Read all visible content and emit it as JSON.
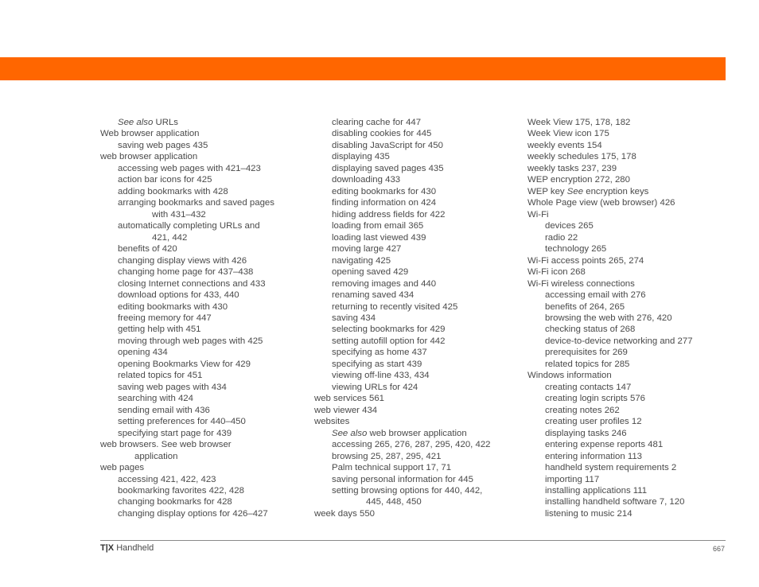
{
  "header": {
    "accent_color": "#ff6600"
  },
  "columns": [
    [
      {
        "level": 1,
        "italic": "See also",
        "text": " URLs"
      },
      {
        "level": 0,
        "text": "Web browser application"
      },
      {
        "level": 1,
        "text": "saving web pages 435"
      },
      {
        "level": 0,
        "text": "web browser application"
      },
      {
        "level": 1,
        "text": "accessing web pages with 421–423"
      },
      {
        "level": 1,
        "text": "action bar icons for 425"
      },
      {
        "level": 1,
        "text": "adding bookmarks with 428"
      },
      {
        "level": 1,
        "text": "arranging bookmarks and saved pages"
      },
      {
        "level": 2,
        "text": "with 431–432"
      },
      {
        "level": 1,
        "text": "automatically completing URLs and"
      },
      {
        "level": 2,
        "text": "421, 442"
      },
      {
        "level": 1,
        "text": "benefits of 420"
      },
      {
        "level": 1,
        "text": "changing display views with 426"
      },
      {
        "level": 1,
        "text": "changing home page for 437–438"
      },
      {
        "level": 1,
        "text": "closing Internet connections and 433"
      },
      {
        "level": 1,
        "text": "download options for 433, 440"
      },
      {
        "level": 1,
        "text": "editing bookmarks with 430"
      },
      {
        "level": 1,
        "text": "freeing memory for 447"
      },
      {
        "level": 1,
        "text": "getting help with 451"
      },
      {
        "level": 1,
        "text": "moving through web pages with 425"
      },
      {
        "level": 1,
        "text": "opening 434"
      },
      {
        "level": 1,
        "text": "opening Bookmarks View for 429"
      },
      {
        "level": 1,
        "text": "related topics for 451"
      },
      {
        "level": 1,
        "text": "saving web pages with 434"
      },
      {
        "level": 1,
        "text": "searching with 424"
      },
      {
        "level": 1,
        "text": "sending email with 436"
      },
      {
        "level": 1,
        "text": "setting preferences for 440–450"
      },
      {
        "level": 1,
        "text": "specifying start page for 439"
      },
      {
        "level": 0,
        "text": "web browsers. See web browser"
      },
      {
        "level": 2,
        "text": "application",
        "indent_small": true
      },
      {
        "level": 0,
        "text": "web pages"
      },
      {
        "level": 1,
        "text": "accessing 421, 422, 423"
      },
      {
        "level": 1,
        "text": "bookmarking favorites 422, 428"
      },
      {
        "level": 1,
        "text": "changing bookmarks for 428"
      },
      {
        "level": 1,
        "text": "changing display options for 426–427"
      }
    ],
    [
      {
        "level": 1,
        "text": "clearing cache for 447"
      },
      {
        "level": 1,
        "text": "disabling cookies for 445"
      },
      {
        "level": 1,
        "text": "disabling JavaScript for 450"
      },
      {
        "level": 1,
        "text": "displaying 435"
      },
      {
        "level": 1,
        "text": "displaying saved pages 435"
      },
      {
        "level": 1,
        "text": "downloading 433"
      },
      {
        "level": 1,
        "text": "editing bookmarks for 430"
      },
      {
        "level": 1,
        "text": "finding information on 424"
      },
      {
        "level": 1,
        "text": "hiding address fields for 422"
      },
      {
        "level": 1,
        "text": "loading from email 365"
      },
      {
        "level": 1,
        "text": "loading last viewed 439"
      },
      {
        "level": 1,
        "text": "moving large 427"
      },
      {
        "level": 1,
        "text": "navigating 425"
      },
      {
        "level": 1,
        "text": "opening saved 429"
      },
      {
        "level": 1,
        "text": "removing images and 440"
      },
      {
        "level": 1,
        "text": "renaming saved 434"
      },
      {
        "level": 1,
        "text": "returning to recently visited 425"
      },
      {
        "level": 1,
        "text": "saving 434"
      },
      {
        "level": 1,
        "text": "selecting bookmarks for 429"
      },
      {
        "level": 1,
        "text": "setting autofill option for 442"
      },
      {
        "level": 1,
        "text": "specifying as home 437"
      },
      {
        "level": 1,
        "text": "specifying as start 439"
      },
      {
        "level": 1,
        "text": "viewing off-line 433, 434"
      },
      {
        "level": 1,
        "text": "viewing URLs for 424"
      },
      {
        "level": 0,
        "text": "web services 561"
      },
      {
        "level": 0,
        "text": "web viewer 434"
      },
      {
        "level": 0,
        "text": "websites"
      },
      {
        "level": 1,
        "italic": "See also",
        "text": " web browser application"
      },
      {
        "level": 1,
        "text": "accessing 265, 276, 287, 295, 420, 422"
      },
      {
        "level": 1,
        "text": "browsing 25, 287, 295, 421"
      },
      {
        "level": 1,
        "text": "Palm technical support 17, 71"
      },
      {
        "level": 1,
        "text": "saving personal information for 445"
      },
      {
        "level": 1,
        "text": "setting browsing options for 440, 442,"
      },
      {
        "level": 2,
        "text": "445, 448, 450"
      },
      {
        "level": 0,
        "text": "week days 550"
      }
    ],
    [
      {
        "level": 0,
        "text": "Week View 175, 178, 182"
      },
      {
        "level": 0,
        "text": "Week View icon 175"
      },
      {
        "level": 0,
        "text": "weekly events 154"
      },
      {
        "level": 0,
        "text": "weekly schedules 175, 178"
      },
      {
        "level": 0,
        "text": "weekly tasks 237, 239"
      },
      {
        "level": 0,
        "text": "WEP encryption 272, 280"
      },
      {
        "level": 0,
        "text": "WEP key ",
        "italic_after": "See",
        "text_after": " encryption keys"
      },
      {
        "level": 0,
        "text": "Whole Page view (web browser) 426"
      },
      {
        "level": 0,
        "text": "Wi-Fi"
      },
      {
        "level": 1,
        "text": "devices 265"
      },
      {
        "level": 1,
        "text": "radio 22"
      },
      {
        "level": 1,
        "text": "technology 265"
      },
      {
        "level": 0,
        "text": "Wi-Fi access points 265, 274"
      },
      {
        "level": 0,
        "text": "Wi-Fi icon 268"
      },
      {
        "level": 0,
        "text": "Wi-Fi wireless connections"
      },
      {
        "level": 1,
        "text": "accessing email with 276"
      },
      {
        "level": 1,
        "text": "benefits of 264, 265"
      },
      {
        "level": 1,
        "text": "browsing the web with 276, 420"
      },
      {
        "level": 1,
        "text": "checking status of 268"
      },
      {
        "level": 1,
        "text": "device-to-device networking and 277"
      },
      {
        "level": 1,
        "text": "prerequisites for 269"
      },
      {
        "level": 1,
        "text": "related topics for 285"
      },
      {
        "level": 0,
        "text": "Windows information"
      },
      {
        "level": 1,
        "text": "creating contacts 147"
      },
      {
        "level": 1,
        "text": "creating login scripts 576"
      },
      {
        "level": 1,
        "text": "creating notes 262"
      },
      {
        "level": 1,
        "text": "creating user profiles 12"
      },
      {
        "level": 1,
        "text": "displaying tasks 246"
      },
      {
        "level": 1,
        "text": "entering expense reports 481"
      },
      {
        "level": 1,
        "text": "entering information 113"
      },
      {
        "level": 1,
        "text": "handheld system requirements 2"
      },
      {
        "level": 1,
        "text": "importing 117"
      },
      {
        "level": 1,
        "text": "installing applications 111"
      },
      {
        "level": 1,
        "text": "installing handheld software 7, 120"
      },
      {
        "level": 1,
        "text": "listening to music 214"
      }
    ]
  ],
  "footer": {
    "product_bold": "T|X",
    "product_rest": " Handheld",
    "page_number": "667"
  }
}
